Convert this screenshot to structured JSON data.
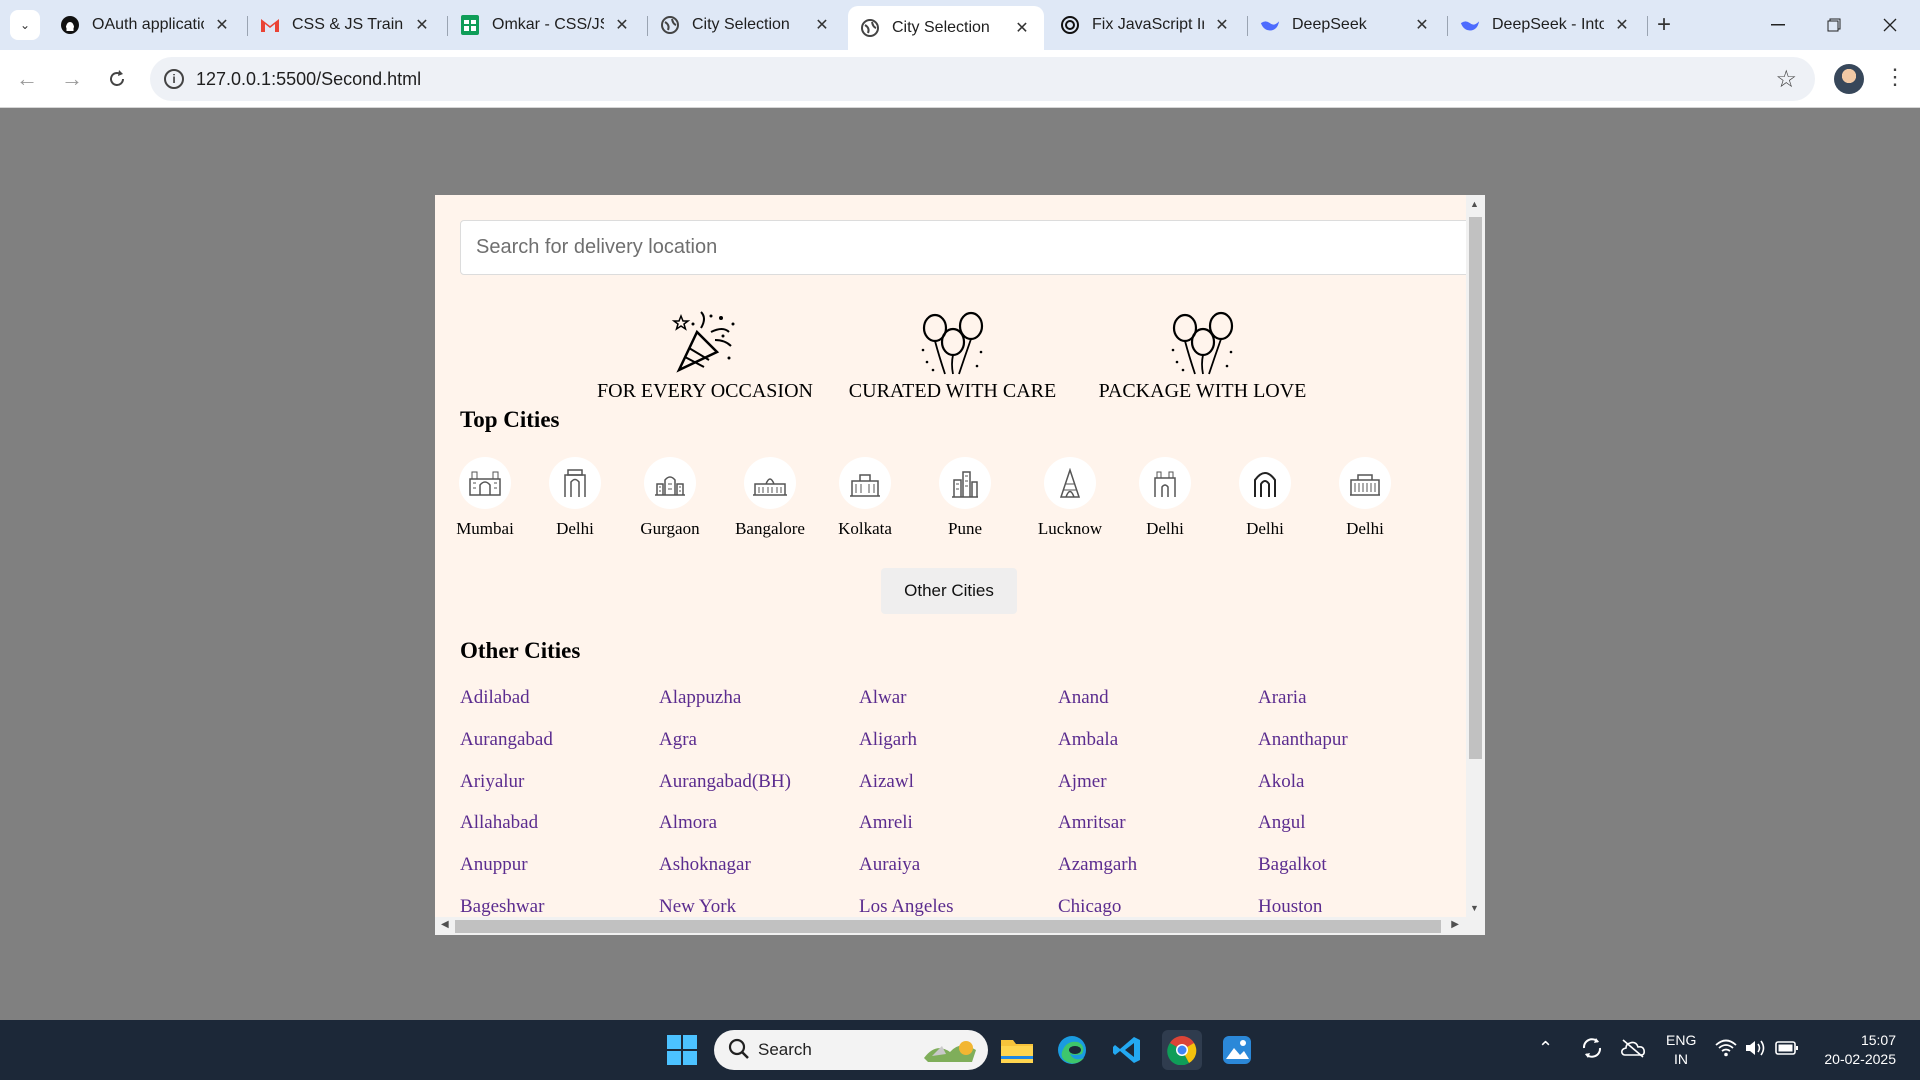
{
  "browser": {
    "tabs": [
      {
        "title": "OAuth applicatio",
        "icon": "github-icon"
      },
      {
        "title": "CSS & JS Trainin",
        "icon": "gmail-icon"
      },
      {
        "title": "Omkar - CSS/JS T",
        "icon": "sheets-icon"
      },
      {
        "title": "City Selection",
        "icon": "globe-icon"
      },
      {
        "title": "City Selection",
        "icon": "globe-icon",
        "active": true
      },
      {
        "title": "Fix JavaScript In",
        "icon": "openai-icon"
      },
      {
        "title": "DeepSeek",
        "icon": "deepseek-icon"
      },
      {
        "title": "DeepSeek - Into",
        "icon": "deepseek-icon"
      }
    ],
    "url": "127.0.0.1:5500/Second.html"
  },
  "page": {
    "search": {
      "placeholder": "Search for delivery location"
    },
    "features": [
      {
        "label": "FOR EVERY OCCASION",
        "icon": "party-popper-icon"
      },
      {
        "label": "CURATED WITH CARE",
        "icon": "balloons-icon"
      },
      {
        "label": "PACKAGE WITH LOVE",
        "icon": "balloons-icon"
      }
    ],
    "top_cities_title": "Top Cities",
    "top_cities": [
      "Mumbai",
      "Delhi",
      "Gurgaon",
      "Bangalore",
      "Kolkata",
      "Pune",
      "Lucknow",
      "Delhi",
      "Delhi",
      "Delhi"
    ],
    "other_cities_button": "Other Cities",
    "other_cities_title": "Other Cities",
    "other_cities": [
      [
        "Adilabad",
        "Alappuzha",
        "Alwar",
        "Anand",
        "Araria"
      ],
      [
        "Aurangabad",
        "Agra",
        "Aligarh",
        "Ambala",
        "Ananthapur"
      ],
      [
        "Ariyalur",
        "Aurangabad(BH)",
        "Aizawl",
        "Ajmer",
        "Akola"
      ],
      [
        "Allahabad",
        "Almora",
        "Amreli",
        "Amritsar",
        "Angul"
      ],
      [
        "Anuppur",
        "Ashoknagar",
        "Auraiya",
        "Azamgarh",
        "Bagalkot"
      ],
      [
        "Bageshwar",
        "New York",
        "Los Angeles",
        "Chicago",
        "Houston"
      ]
    ],
    "colors": {
      "panel": "#fff4ec",
      "link": "#5b2c8f",
      "backdrop": "#808080"
    }
  },
  "taskbar": {
    "search_label": "Search",
    "lang": "ENG",
    "region": "IN",
    "time": "15:07",
    "date": "20-02-2025"
  }
}
